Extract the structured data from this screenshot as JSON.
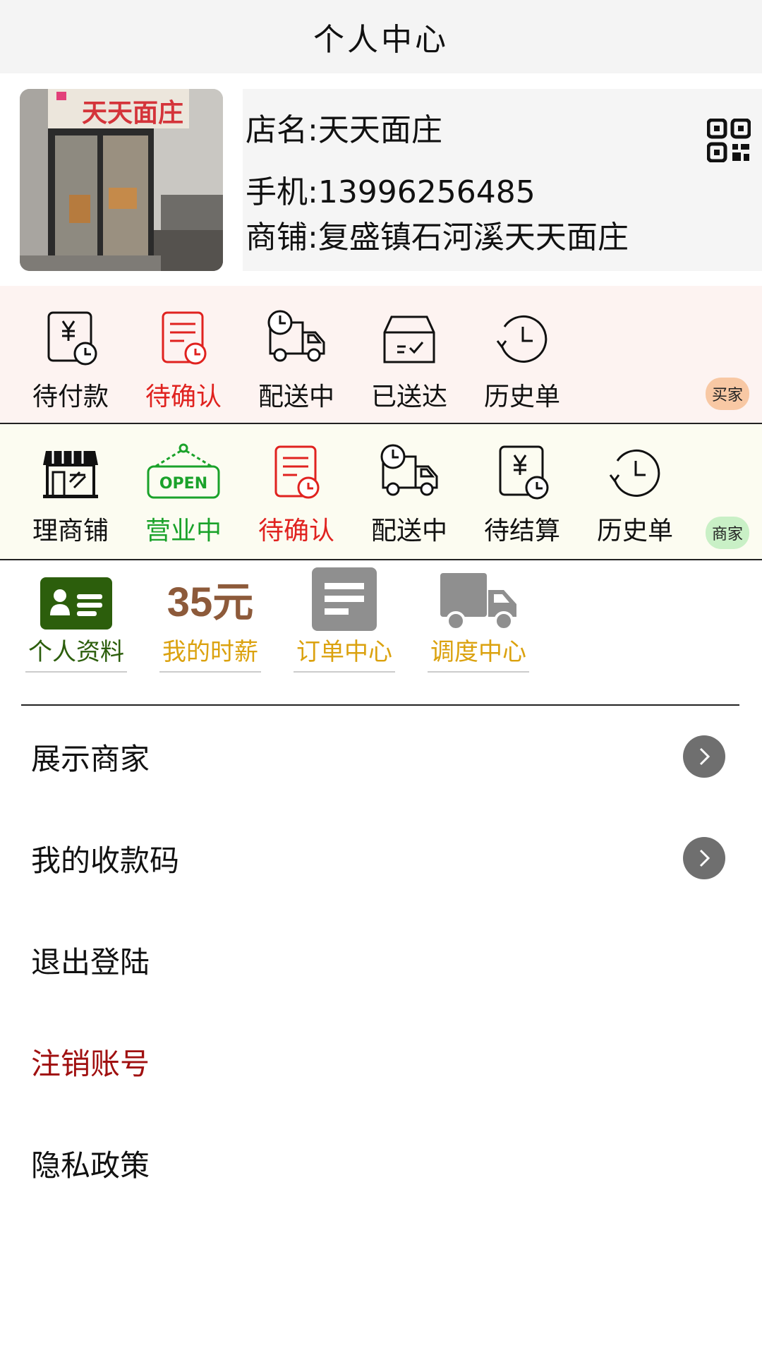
{
  "header": {
    "title": "个人中心"
  },
  "shop": {
    "name_line": "店名:天天面庄",
    "phone_line": "手机:13996256485",
    "store_line": "商铺:复盛镇石河溪天天面庄",
    "sign_text": "天天面庄"
  },
  "buyer_row": {
    "tag": "买家",
    "items": [
      {
        "label": "待付款",
        "icon": "yuan-clock-icon"
      },
      {
        "label": "待确认",
        "icon": "document-clock-icon"
      },
      {
        "label": "配送中",
        "icon": "delivery-truck-icon"
      },
      {
        "label": "已送达",
        "icon": "delivered-box-icon"
      },
      {
        "label": "历史单",
        "icon": "history-clock-icon"
      }
    ]
  },
  "merchant_row": {
    "tag": "商家",
    "items": [
      {
        "label": "理商铺",
        "icon": "storefront-icon"
      },
      {
        "label": "营业中",
        "icon": "open-sign-icon",
        "sign": "OPEN"
      },
      {
        "label": "待确认",
        "icon": "document-clock-icon"
      },
      {
        "label": "配送中",
        "icon": "delivery-truck-icon"
      },
      {
        "label": "待结算",
        "icon": "yuan-clock-icon"
      },
      {
        "label": "历史单",
        "icon": "history-clock-icon"
      }
    ]
  },
  "features": {
    "profile": {
      "label": "个人资料",
      "icon": "id-card-icon"
    },
    "wage": {
      "label": "我的时薪",
      "value": "35元"
    },
    "orders": {
      "label": "订单中心",
      "icon": "order-document-icon"
    },
    "dispatch": {
      "label": "调度中心",
      "icon": "truck-icon"
    }
  },
  "menu": [
    {
      "label": "展示商家",
      "has_arrow": true
    },
    {
      "label": "我的收款码",
      "has_arrow": true
    },
    {
      "label": "退出登陆",
      "has_arrow": false
    },
    {
      "label": "注销账号",
      "has_arrow": false
    },
    {
      "label": "隐私政策",
      "has_arrow": false
    }
  ],
  "colors": {
    "danger_red": "#e0221f",
    "open_green": "#1aa22a",
    "feature_gold": "#dba20f",
    "feature_green": "#2c5e0c",
    "logout_red": "#a01010"
  }
}
